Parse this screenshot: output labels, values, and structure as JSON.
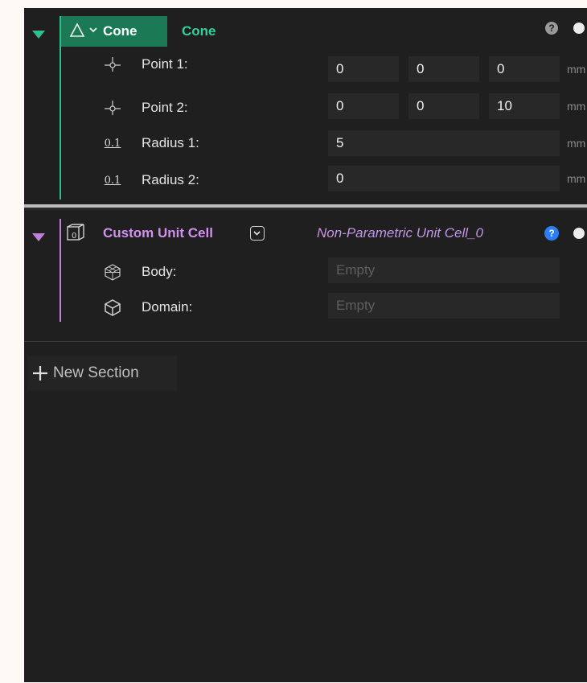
{
  "colors": {
    "panel_bg": "#1f1f1f",
    "cone_accent": "#2fbf8f",
    "cone_tag_bg": "#1b7a55",
    "unit_cell_accent": "#c07fd8",
    "help_blue": "#2d7df6"
  },
  "cone_section": {
    "expand_icon": "triangle-down-green",
    "shape_icon": "triangle-outline-icon",
    "type_label": "Cone",
    "name": "Cone",
    "help_icon": "question-circle-grey",
    "rows": [
      {
        "icon": "point-icon",
        "icon_text": "-¤-",
        "label": "Point 1:",
        "values": [
          "0",
          "0",
          "0"
        ],
        "unit": "mm"
      },
      {
        "icon": "point-icon",
        "icon_text": "-¤-",
        "label": "Point 2:",
        "values": [
          "0",
          "0",
          "10"
        ],
        "unit": "mm"
      },
      {
        "icon": "decimal-icon",
        "icon_text": "0.1",
        "label": "Radius 1:",
        "values": [
          "5"
        ],
        "unit": "mm"
      },
      {
        "icon": "decimal-icon",
        "icon_text": "0.1",
        "label": "Radius 2:",
        "values": [
          "0"
        ],
        "unit": "mm"
      }
    ]
  },
  "unit_cell_section": {
    "expand_icon": "triangle-down-purple",
    "cell_icon": "unit-cell-icon",
    "type_label": "Custom Unit Cell",
    "dropdown_icon": "chevron-down-icon",
    "name": "Non-Parametric Unit Cell_0",
    "help_icon": "question-circle-blue",
    "rows": [
      {
        "icon": "body-mesh-icon",
        "label": "Body:",
        "placeholder": "Empty"
      },
      {
        "icon": "domain-cube-icon",
        "label": "Domain:",
        "placeholder": "Empty"
      }
    ]
  },
  "new_section": {
    "icon": "plus-icon",
    "label": "New Section"
  }
}
